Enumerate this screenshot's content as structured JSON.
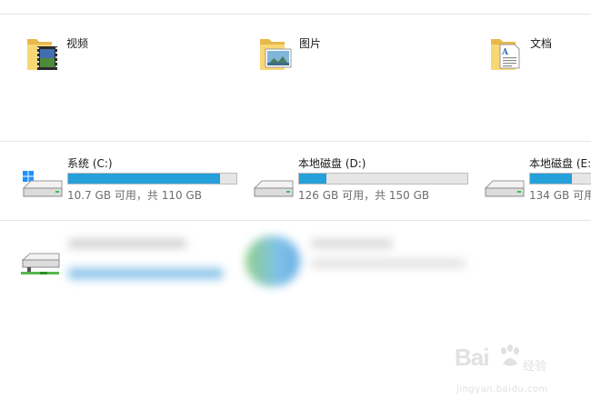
{
  "folders": [
    {
      "name": "视频",
      "icon": "video-folder-icon"
    },
    {
      "name": "图片",
      "icon": "pictures-folder-icon"
    },
    {
      "name": "文档",
      "icon": "documents-folder-icon"
    }
  ],
  "drives": [
    {
      "name": "系统 (C:)",
      "free_text": "10.7 GB 可用，共 110 GB",
      "used_fraction": 0.903,
      "icon": "windows-system-drive-icon"
    },
    {
      "name": "本地磁盘 (D:)",
      "free_text": "126 GB 可用，共 150 GB",
      "used_fraction": 0.16,
      "icon": "hard-drive-icon"
    },
    {
      "name": "本地磁盘 (E:)",
      "free_text": "134 GB 可用",
      "used_fraction": 0.25,
      "icon": "hard-drive-icon"
    }
  ],
  "network": {
    "icon": "network-drive-icon"
  },
  "colors": {
    "bar_fill": "#26a0da",
    "bar_track": "#e6e6e6",
    "folder": "#f8d775"
  },
  "watermark": {
    "logo": "Bai",
    "logo2": "经验",
    "url": "jingyan.baidu.com"
  }
}
